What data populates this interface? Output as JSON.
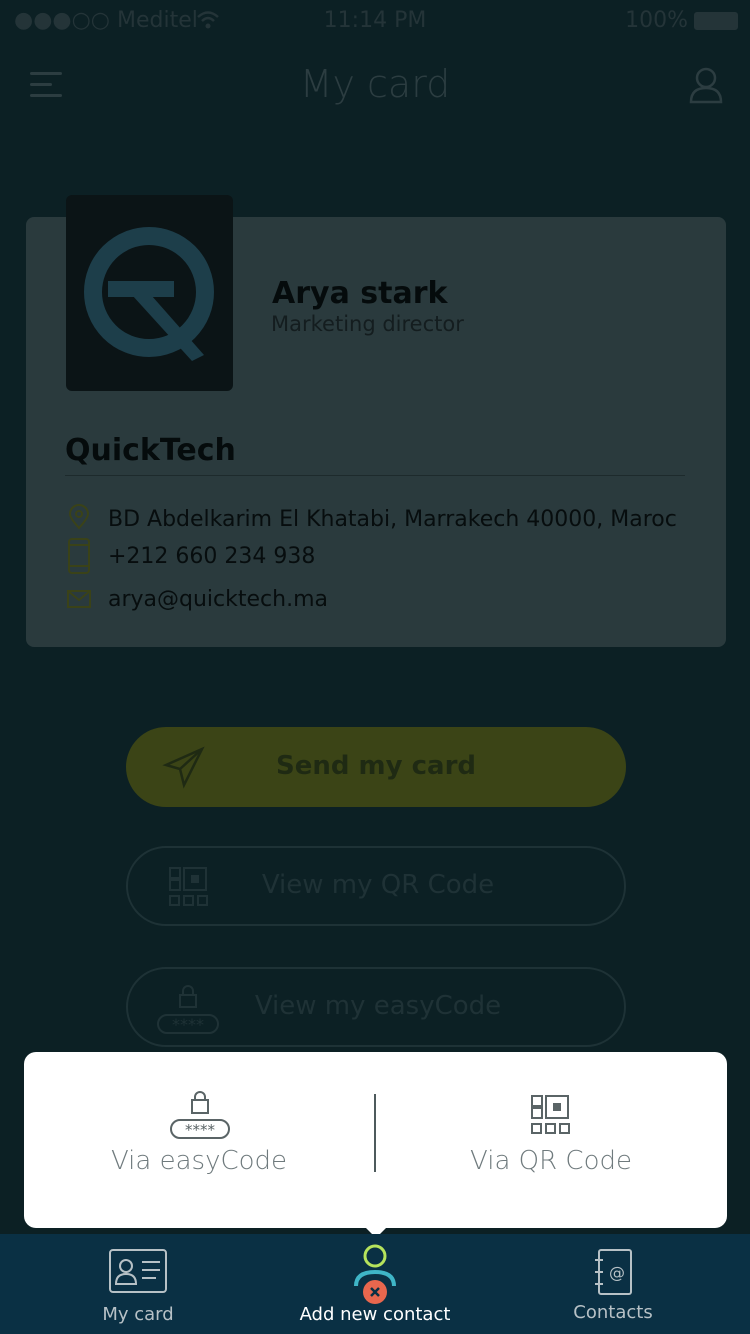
{
  "status_bar": {
    "carrier": "●●●○○ Meditel",
    "time": "11:14 PM",
    "battery": "100%"
  },
  "nav": {
    "title": "My card"
  },
  "card": {
    "name": "Arya stark",
    "job_title": "Marketing director",
    "company": "QuickTech",
    "address": "BD Abdelkarim El Khatabi, Marrakech 40000, Maroc",
    "phone": "+212 660 234 938",
    "email": "arya@quicktech.ma"
  },
  "actions": {
    "send_label": "Send my card",
    "qr_label": "View my QR Code",
    "easycode_label": "View my easyCode"
  },
  "popup": {
    "easycode_label": "Via easyCode",
    "qr_label": "Via QR Code",
    "code_mask": "****"
  },
  "tabs": {
    "my_card": "My card",
    "add_contact": "Add  new contact",
    "contacts": "Contacts"
  },
  "colors": {
    "accent_yellow_green": "#c2d22b",
    "tab_bar": "#0a3044",
    "close_badge": "#e8674e",
    "active_ring": "#b6e35c"
  }
}
